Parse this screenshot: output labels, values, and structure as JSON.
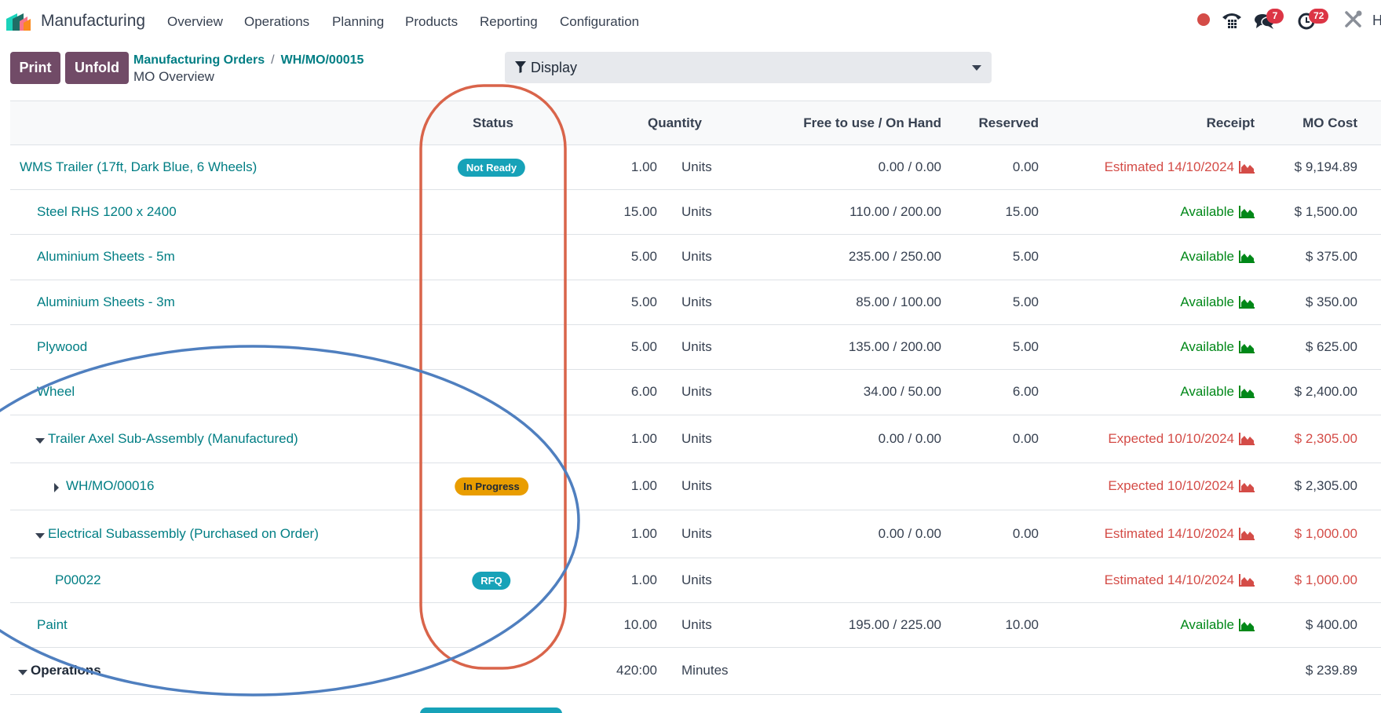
{
  "navbar": {
    "app_title": "Manufacturing",
    "menu": [
      "Overview",
      "Operations",
      "Planning",
      "Products",
      "Reporting",
      "Configuration"
    ],
    "systray": {
      "recording_icon": "record-dot-icon",
      "phone_icon": "phone-icon",
      "messages_icon": "chat-bubbles-icon",
      "messages_count": "7",
      "activities_icon": "clock-icon",
      "activities_count": "72",
      "debug_icon": "tools-icon",
      "user_initial": "H"
    }
  },
  "control_panel": {
    "print_label": "Print",
    "unfold_label": "Unfold",
    "breadcrumb": [
      "Manufacturing Orders",
      "WH/MO/00015"
    ],
    "subtitle": "MO Overview",
    "display_label": "Display"
  },
  "table": {
    "headers": {
      "name": "",
      "status": "Status",
      "quantity": "Quantity",
      "free_on_hand": "Free to use / On Hand",
      "reserved": "Reserved",
      "receipt": "Receipt",
      "mo_cost": "MO Cost"
    },
    "rows": [
      {
        "name": "WMS Trailer (17ft, Dark Blue, 6 Wheels)",
        "level": 0,
        "fold": "",
        "status": "Not Ready",
        "status_color": "#17a2b8",
        "qty": "1.00",
        "uom": "Units",
        "free_on_hand": "0.00 / 0.00",
        "reserved": "0.00",
        "receipt": "Estimated 14/10/2024",
        "receipt_state": "red",
        "cost": "$ 9,194.89",
        "cost_state": "normal"
      },
      {
        "name": "Steel RHS 1200 x 2400",
        "level": 1,
        "fold": "",
        "status": "",
        "qty": "15.00",
        "uom": "Units",
        "free_on_hand": "110.00 / 200.00",
        "reserved": "15.00",
        "receipt": "Available",
        "receipt_state": "green",
        "cost": "$ 1,500.00",
        "cost_state": "normal"
      },
      {
        "name": "Aluminium Sheets - 5m",
        "level": 1,
        "fold": "",
        "status": "",
        "qty": "5.00",
        "uom": "Units",
        "free_on_hand": "235.00 / 250.00",
        "reserved": "5.00",
        "receipt": "Available",
        "receipt_state": "green",
        "cost": "$ 375.00",
        "cost_state": "normal"
      },
      {
        "name": "Aluminium Sheets - 3m",
        "level": 1,
        "fold": "",
        "status": "",
        "qty": "5.00",
        "uom": "Units",
        "free_on_hand": "85.00 / 100.00",
        "reserved": "5.00",
        "receipt": "Available",
        "receipt_state": "green",
        "cost": "$ 350.00",
        "cost_state": "normal"
      },
      {
        "name": "Plywood",
        "level": 1,
        "fold": "",
        "status": "",
        "qty": "5.00",
        "uom": "Units",
        "free_on_hand": "135.00 / 200.00",
        "reserved": "5.00",
        "receipt": "Available",
        "receipt_state": "green",
        "cost": "$ 625.00",
        "cost_state": "normal"
      },
      {
        "name": "Wheel",
        "level": 1,
        "fold": "",
        "status": "",
        "qty": "6.00",
        "uom": "Units",
        "free_on_hand": "34.00 / 50.00",
        "reserved": "6.00",
        "receipt": "Available",
        "receipt_state": "green",
        "cost": "$ 2,400.00",
        "cost_state": "normal"
      },
      {
        "name": "Trailer Axel Sub-Assembly (Manufactured)",
        "level": 1,
        "fold": "down",
        "status": "",
        "qty": "1.00",
        "uom": "Units",
        "free_on_hand": "0.00 / 0.00",
        "reserved": "0.00",
        "receipt": "Expected 10/10/2024",
        "receipt_state": "red",
        "cost": "$ 2,305.00",
        "cost_state": "red"
      },
      {
        "name": "WH/MO/00016",
        "level": 2,
        "fold": "right",
        "status": "In Progress",
        "status_color": "#e99d00",
        "qty": "1.00",
        "uom": "Units",
        "free_on_hand": "",
        "reserved": "",
        "receipt": "Expected 10/10/2024",
        "receipt_state": "red",
        "cost": "$ 2,305.00",
        "cost_state": "normal"
      },
      {
        "name": "Electrical Subassembly (Purchased on Order)",
        "level": 1,
        "fold": "down",
        "status": "",
        "qty": "1.00",
        "uom": "Units",
        "free_on_hand": "0.00 / 0.00",
        "reserved": "0.00",
        "receipt": "Estimated 14/10/2024",
        "receipt_state": "red",
        "cost": "$ 1,000.00",
        "cost_state": "red"
      },
      {
        "name": "P00022",
        "level": 2,
        "fold": "",
        "status": "RFQ",
        "status_color": "#17a2b8",
        "qty": "1.00",
        "uom": "Units",
        "free_on_hand": "",
        "reserved": "",
        "receipt": "Estimated 14/10/2024",
        "receipt_state": "red",
        "cost": "$ 1,000.00",
        "cost_state": "red"
      },
      {
        "name": "Paint",
        "level": 1,
        "fold": "",
        "status": "",
        "qty": "10.00",
        "uom": "Units",
        "free_on_hand": "195.00 / 225.00",
        "reserved": "10.00",
        "receipt": "Available",
        "receipt_state": "green",
        "cost": "$ 400.00",
        "cost_state": "normal"
      },
      {
        "name": "Operations",
        "level": 0,
        "fold": "down",
        "bold": true,
        "status": "",
        "qty": "420:00",
        "uom": "Minutes",
        "free_on_hand": "",
        "reserved": "",
        "receipt": "",
        "receipt_state": "",
        "cost": "$ 239.89",
        "cost_state": "normal"
      }
    ]
  },
  "colors": {
    "brand": "#714b67",
    "link": "#017e84",
    "danger": "#d44c47",
    "success": "#008818",
    "annotation_red": "#d9644a",
    "annotation_blue": "#4f7fbf"
  }
}
